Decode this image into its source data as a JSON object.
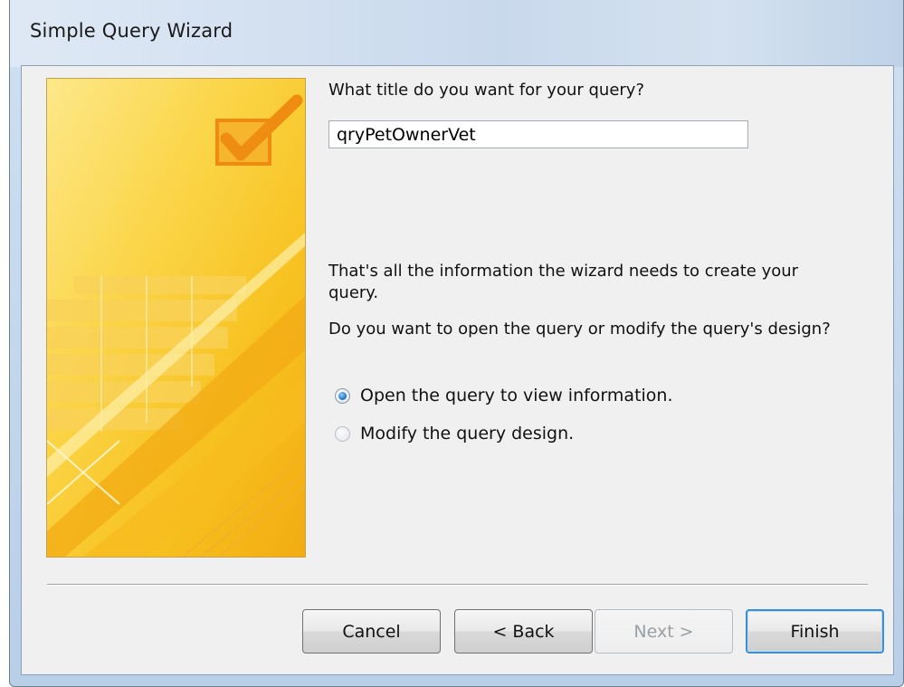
{
  "window": {
    "title": "Simple Query Wizard"
  },
  "content": {
    "question": "What title do you want for your query?",
    "query_title_value": "qryPetOwnerVet",
    "info_line1": "That's all the information the wizard needs to create your",
    "info_line2": "query.",
    "open_or_modify": "Do you want to open the query or modify the query's design?",
    "options": [
      {
        "label": "Open the query to view information.",
        "selected": true
      },
      {
        "label": "Modify the query design.",
        "selected": false
      }
    ]
  },
  "buttons": {
    "cancel": "Cancel",
    "back": "< Back",
    "next": "Next >",
    "finish": "Finish"
  },
  "colors": {
    "banner_yellow": "#f8c71c",
    "banner_light": "#fde37a",
    "banner_orange": "#f0a613",
    "accent_blue": "#3d8fd1"
  }
}
